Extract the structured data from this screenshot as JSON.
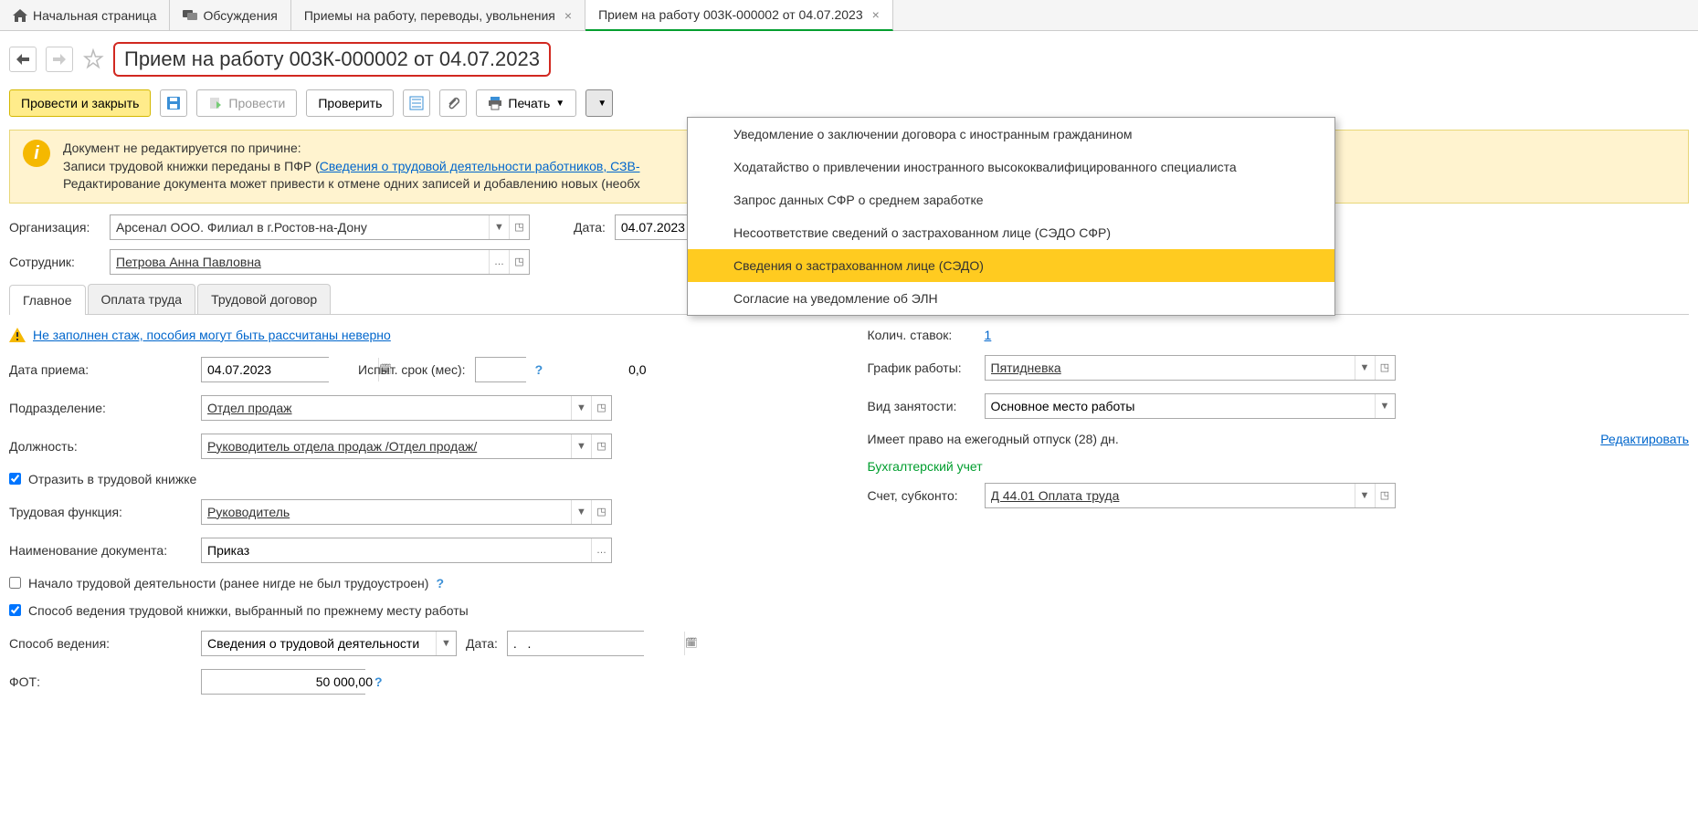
{
  "tabs": {
    "home": "Начальная страница",
    "discuss": "Обсуждения",
    "hires": "Приемы на работу, переводы, увольнения",
    "current": "Прием на работу 003К-000002 от 04.07.2023"
  },
  "page_title": "Прием на работу 003К-000002 от 04.07.2023",
  "toolbar": {
    "post_close": "Провести и закрыть",
    "post": "Провести",
    "check": "Проверить",
    "print": "Печать"
  },
  "info": {
    "line1": "Документ не редактируется по причине:",
    "line2_a": "Записи трудовой книжки переданы в ПФР (",
    "line2_link": "Сведения о трудовой деятельности работников, СЗВ-",
    "line3": "Редактирование документа может привести к отмене одних записей и добавлению новых (необх"
  },
  "header_fields": {
    "org_label": "Организация:",
    "org_value": "Арсенал ООО. Филиал в г.Ростов-на-Дону",
    "date_label": "Дата:",
    "date_value": "04.07.2023",
    "emp_label": "Сотрудник:",
    "emp_value": "Петрова Анна Павловна"
  },
  "sub_tabs": {
    "main": "Главное",
    "pay": "Оплата труда",
    "contract": "Трудовой договор"
  },
  "warning_link": "Не заполнен стаж, пособия могут быть рассчитаны неверно",
  "left": {
    "hire_date_label": "Дата приема:",
    "hire_date": "04.07.2023",
    "trial_label": "Испыт. срок (мес):",
    "trial_val": "0,0",
    "dept_label": "Подразделение:",
    "dept_val": "Отдел продаж",
    "pos_label": "Должность:",
    "pos_val": "Руководитель отдела продаж /Отдел продаж/",
    "cb_workbook": "Отразить в трудовой книжке",
    "func_label": "Трудовая функция:",
    "func_val": "Руководитель",
    "docname_label": "Наименование документа:",
    "docname_val": "Приказ",
    "cb_start": "Начало трудовой деятельности (ранее нигде не был трудоустроен)",
    "cb_method": "Способ ведения трудовой книжки, выбранный по прежнему месту работы",
    "method_label": "Способ ведения:",
    "method_val": "Сведения о трудовой деятельности",
    "method_date_label": "Дата:",
    "method_date_val": ".   .",
    "fot_label": "ФОТ:",
    "fot_val": "50 000,00"
  },
  "right": {
    "rates_label": "Колич. ставок:",
    "rates_val": "1",
    "schedule_label": "График работы:",
    "schedule_val": "Пятидневка",
    "emptype_label": "Вид занятости:",
    "emptype_val": "Основное место работы",
    "vacation_text": "Имеет право на ежегодный отпуск (28) дн.",
    "edit_link": "Редактировать",
    "accounting_head": "Бухгалтерский учет",
    "account_label": "Счет, субконто:",
    "account_val": "Д 44.01 Оплата труда"
  },
  "dropdown": [
    "Уведомление о заключении договора с иностранным гражданином",
    "Ходатайство о привлечении иностранного высококвалифицированного специалиста",
    "Запрос данных СФР о среднем заработке",
    "Несоответствие сведений о застрахованном лице (СЭДО СФР)",
    "Сведения о застрахованном лице (СЭДО)",
    "Согласие на уведомление об ЭЛН"
  ]
}
